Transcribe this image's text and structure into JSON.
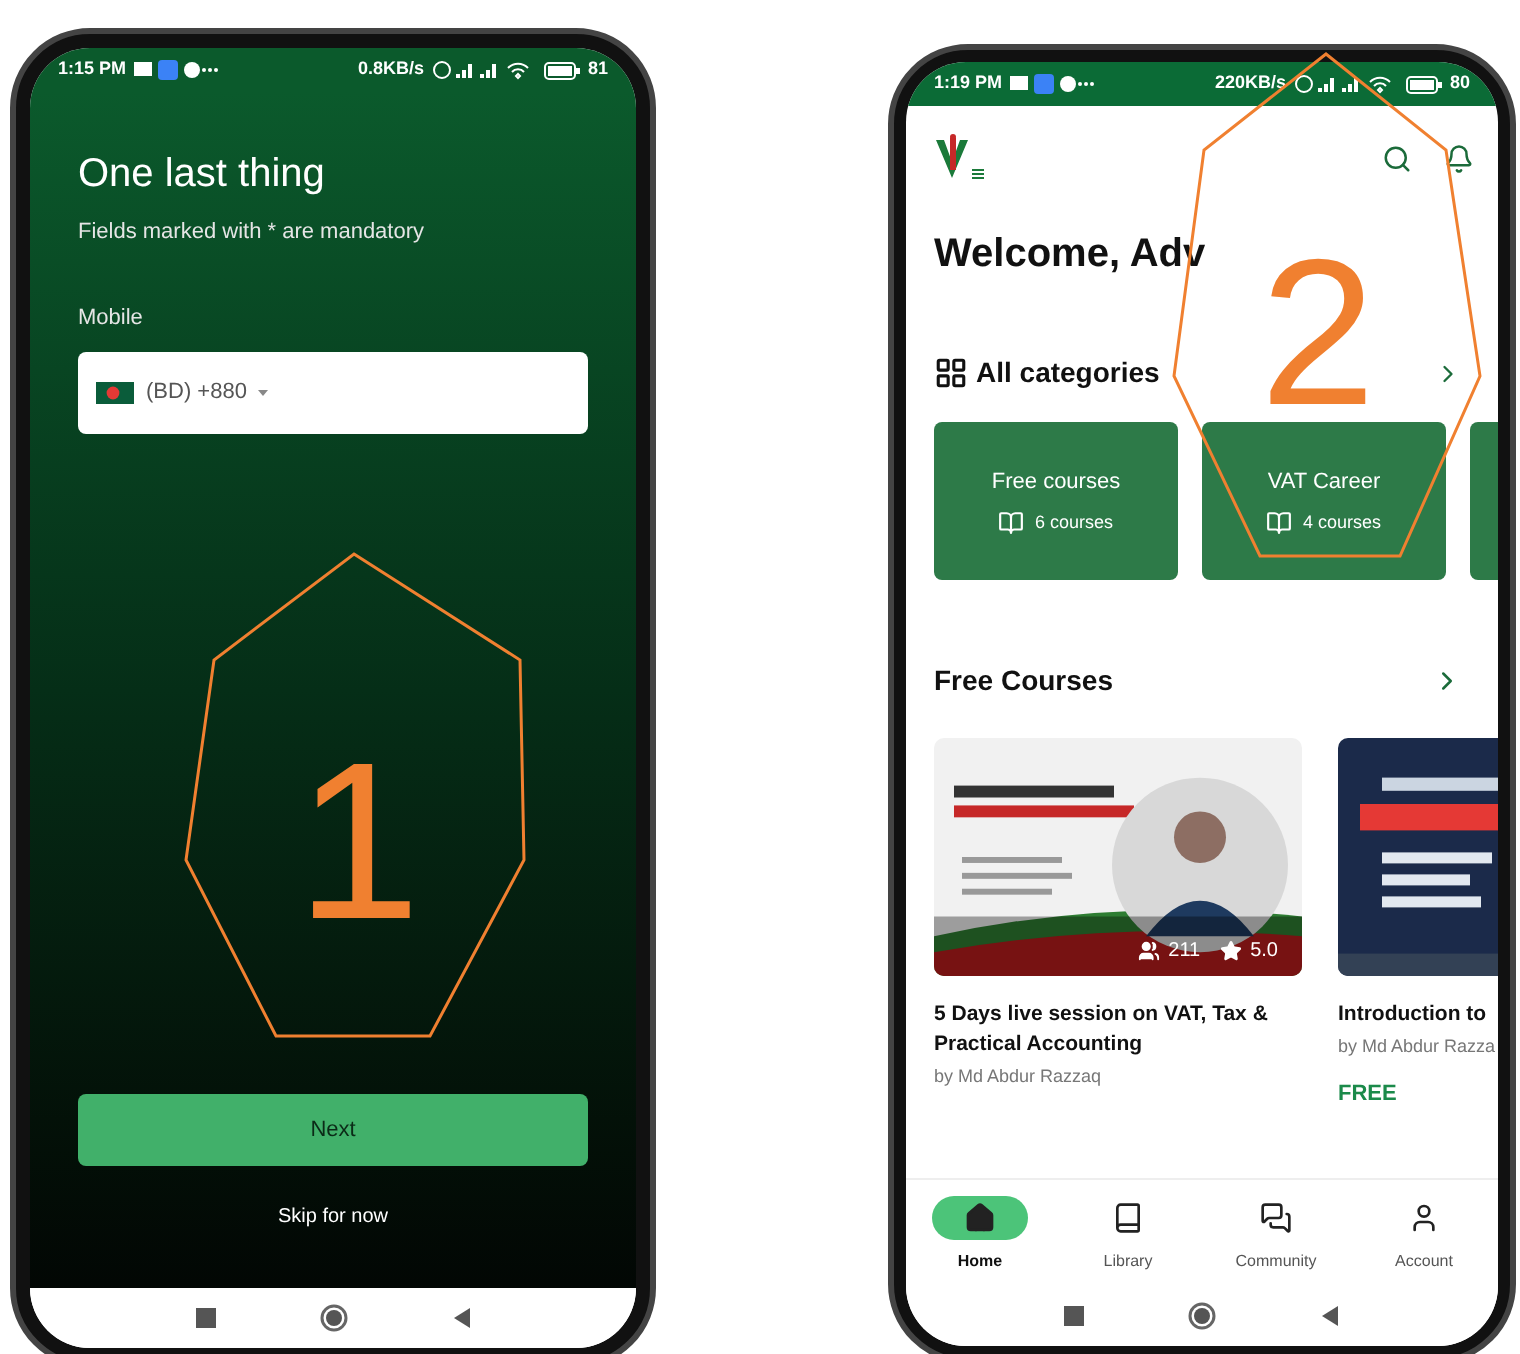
{
  "screen_1": {
    "status_bar": {
      "time": "1:15 PM",
      "speed": "0.8KB/s",
      "battery": "81"
    },
    "title": "One last thing",
    "subtitle": "Fields marked with * are mandatory",
    "field_label": "Mobile",
    "country_code": "(BD) +880",
    "next_button": "Next",
    "skip_link": "Skip for now"
  },
  "screen_2": {
    "status_bar": {
      "time": "1:19 PM",
      "speed": "220KB/s",
      "battery": "80"
    },
    "greeting": "Welcome, Adv",
    "categories_heading": "All categories",
    "categories": [
      {
        "name": "Free courses",
        "count": "6 courses"
      },
      {
        "name": "VAT Career",
        "count": "4 courses"
      }
    ],
    "free_courses_heading": "Free Courses",
    "courses": [
      {
        "kind": "light",
        "title": "5 Days live session on VAT, Tax & Practical Accounting",
        "author": "by Md Abdur Razzaq",
        "students": "211",
        "rating": "5.0"
      },
      {
        "kind": "dark",
        "title": "Introduction to",
        "author": "by Md Abdur Razza",
        "price": "FREE"
      }
    ],
    "bottom_nav": [
      {
        "label": "Home",
        "selected": true
      },
      {
        "label": "Library",
        "selected": false
      },
      {
        "label": "Community",
        "selected": false
      },
      {
        "label": "Account",
        "selected": false
      }
    ]
  },
  "annotations": [
    {
      "label": "1"
    },
    {
      "label": "2"
    }
  ]
}
